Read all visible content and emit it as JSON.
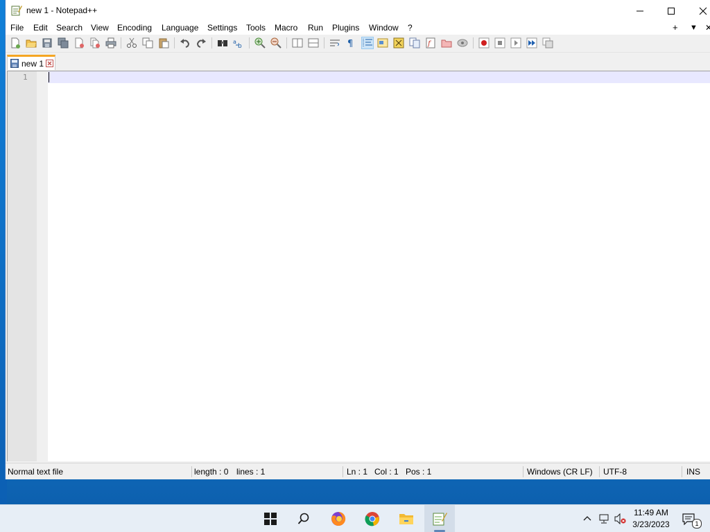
{
  "window": {
    "title": "new 1 - Notepad++"
  },
  "menu": {
    "items": [
      "File",
      "Edit",
      "Search",
      "View",
      "Encoding",
      "Language",
      "Settings",
      "Tools",
      "Macro",
      "Run",
      "Plugins",
      "Window",
      "?"
    ],
    "right_buttons": [
      "+",
      "▼",
      "✕"
    ]
  },
  "toolbar": {
    "icons": [
      "new-file-icon",
      "open-file-icon",
      "save-icon",
      "save-all-icon",
      "close-icon",
      "close-all-icon",
      "print-icon",
      "cut-icon",
      "copy-icon",
      "paste-icon",
      "undo-icon",
      "redo-icon",
      "find-icon",
      "replace-icon",
      "zoom-in-icon",
      "zoom-out-icon",
      "sync-vertical-icon",
      "sync-horizontal-icon",
      "word-wrap-icon",
      "show-all-characters-icon",
      "indent-guide-icon",
      "user-defined-language-icon",
      "document-map-icon",
      "document-list-icon",
      "function-list-icon",
      "folder-as-workspace-icon",
      "monitoring-icon",
      "macro-record-icon",
      "macro-stop-icon",
      "macro-play-icon",
      "macro-run-multiple-icon",
      "macro-save-icon"
    ],
    "active_icon": "indent-guide-icon"
  },
  "tabs": [
    {
      "label": "new 1",
      "active": true
    }
  ],
  "editor": {
    "line_numbers": [
      "1"
    ],
    "content": ""
  },
  "statusbar": {
    "file_type": "Normal text file",
    "length": "length : 0",
    "lines": "lines : 1",
    "ln": "Ln : 1",
    "col": "Col : 1",
    "pos": "Pos : 1",
    "eol": "Windows (CR LF)",
    "encoding": "UTF-8",
    "mode": "INS"
  },
  "taskbar": {
    "apps": [
      "windows-start-icon",
      "search-icon",
      "firefox-icon",
      "chrome-icon",
      "file-explorer-icon",
      "notepadpp-icon"
    ],
    "active_app": "notepadpp-icon",
    "tray": [
      "show-hidden-icons-chevron",
      "network-icon",
      "volume-muted-icon"
    ],
    "time": "11:49 AM",
    "date": "3/23/2023",
    "notification_count": "1"
  },
  "colors": {
    "desktop": "#1d86d8",
    "window_chrome": "#f0f0f0",
    "current_line": "#e8e8ff",
    "tab_accent": "#f5a623",
    "taskbar": "#e7eef6"
  }
}
